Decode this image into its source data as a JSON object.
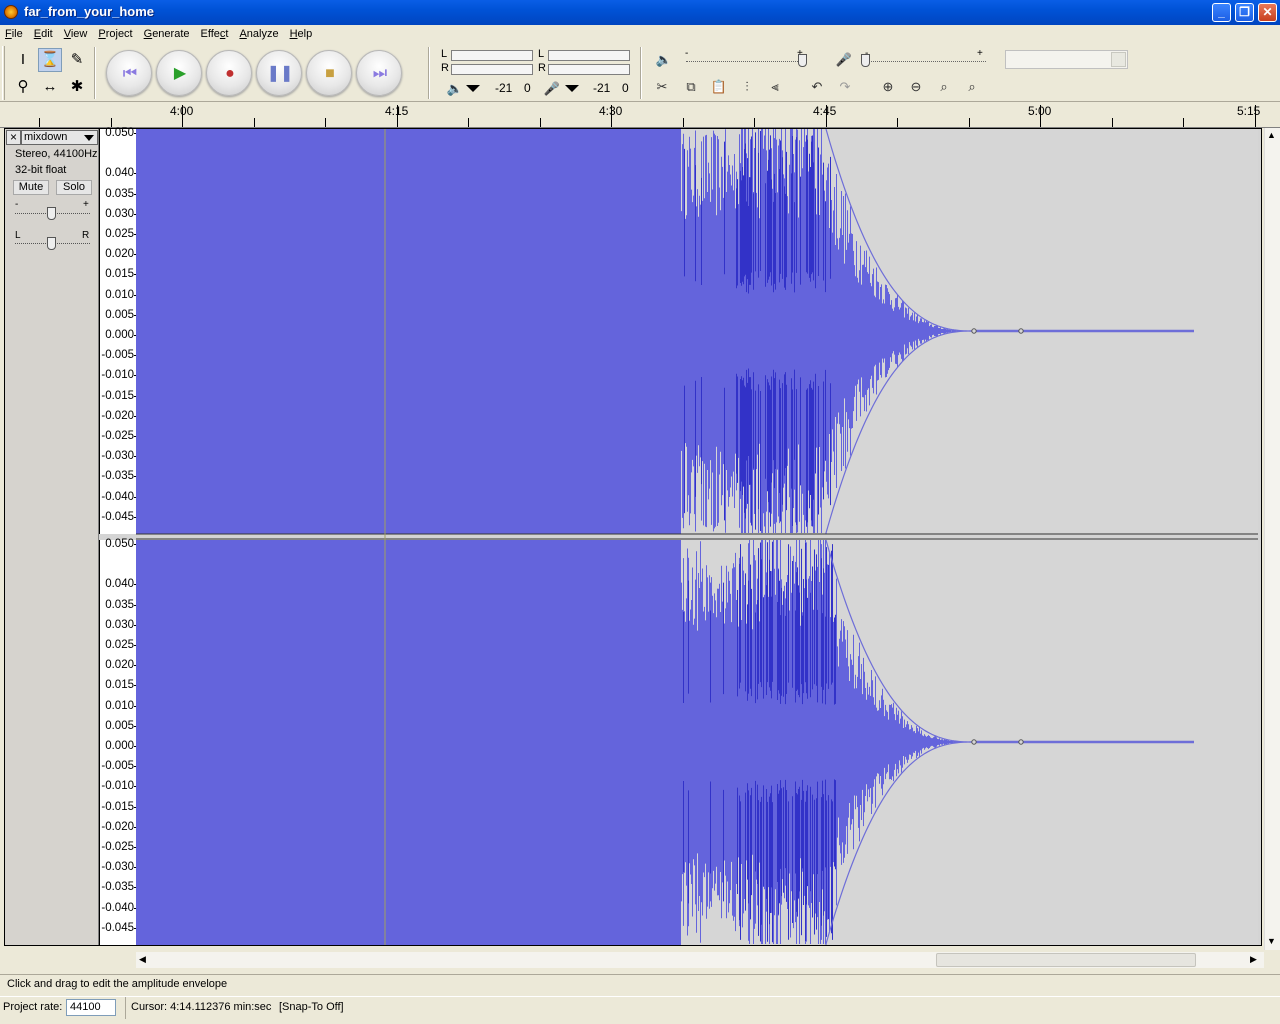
{
  "window": {
    "title": "far_from_your_home"
  },
  "menu": [
    {
      "pre": "",
      "u": "F",
      "post": "ile"
    },
    {
      "pre": "",
      "u": "E",
      "post": "dit"
    },
    {
      "pre": "",
      "u": "V",
      "post": "iew"
    },
    {
      "pre": "",
      "u": "P",
      "post": "roject"
    },
    {
      "pre": "",
      "u": "G",
      "post": "enerate"
    },
    {
      "pre": "Effe",
      "u": "c",
      "post": "t"
    },
    {
      "pre": "",
      "u": "A",
      "post": "nalyze"
    },
    {
      "pre": "",
      "u": "H",
      "post": "elp"
    }
  ],
  "meters": {
    "playback": {
      "l": "L",
      "r": "R",
      "value_a": "-21",
      "value_b": "0"
    },
    "record": {
      "l": "L",
      "r": "R",
      "value_a": "-21",
      "value_b": "0"
    }
  },
  "sliders": {
    "minus": "-",
    "plus": "+"
  },
  "ruler": {
    "labels": [
      "4:00",
      "4:15",
      "4:30",
      "4:45",
      "5:00",
      "5:15"
    ]
  },
  "track": {
    "name": "mixdown",
    "info1": "Stereo, 44100Hz",
    "info2": "32-bit float",
    "mute": "Mute",
    "solo": "Solo",
    "gain_minus": "-",
    "gain_plus": "+",
    "pan_l": "L",
    "pan_r": "R",
    "close": "×",
    "vruler_ticks": [
      "0.050",
      "0.040",
      "0.035",
      "0.030",
      "0.025",
      "0.020",
      "0.015",
      "0.010",
      "0.005",
      "0.000",
      "-0.005",
      "-0.010",
      "-0.015",
      "-0.020",
      "-0.025",
      "-0.030",
      "-0.035",
      "-0.040",
      "-0.045"
    ]
  },
  "status": {
    "message": "Click and drag to edit the amplitude envelope"
  },
  "bottom": {
    "rate_label": "Project rate:",
    "rate_value": "44100",
    "cursor": "Cursor: 4:14.112376 min:sec",
    "snap": "[Snap-To Off]"
  },
  "colors": {
    "waveform": "#6464dc",
    "waveform_dark": "#3232c8",
    "background": "#d6d6d6",
    "envelope": "#6e6ed8"
  }
}
